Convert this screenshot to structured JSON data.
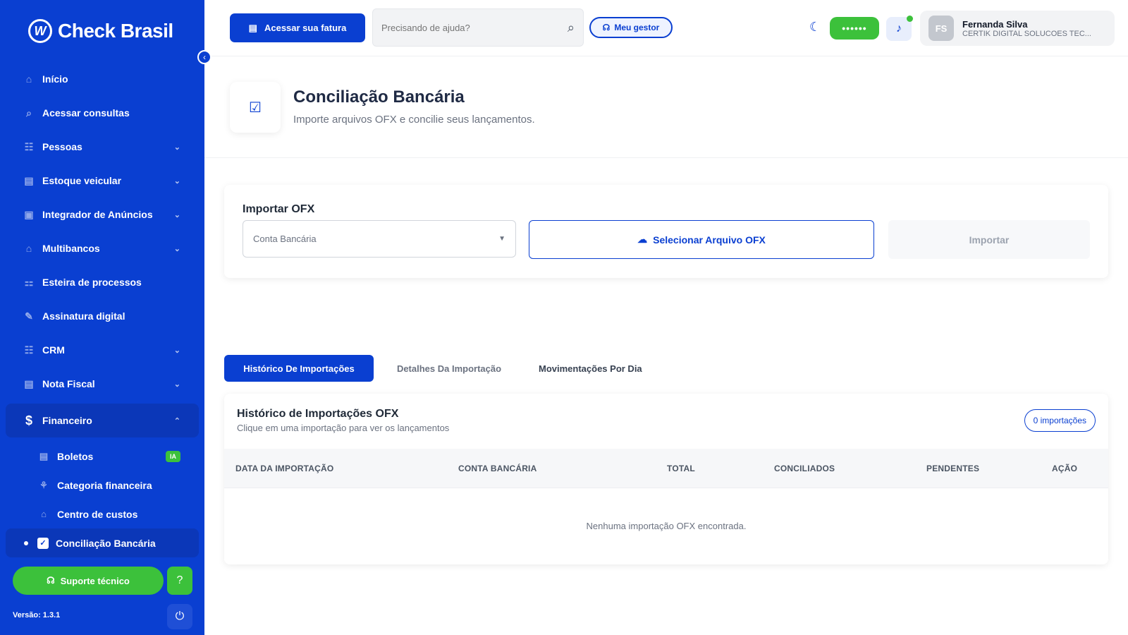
{
  "sidebar": {
    "brand": "Check Brasil",
    "brand_logo_letter": "W",
    "collapse_icon": "‹",
    "items": [
      {
        "label": "Início",
        "icon": "⌂",
        "chevron": ""
      },
      {
        "label": "Acessar consultas",
        "icon": "⌕",
        "chevron": ""
      },
      {
        "label": "Pessoas",
        "icon": "☷",
        "chevron": "⌄"
      },
      {
        "label": "Estoque veicular",
        "icon": "▤",
        "chevron": "⌄"
      },
      {
        "label": "Integrador de Anúncios",
        "icon": "▣",
        "chevron": "⌄"
      },
      {
        "label": "Multibancos",
        "icon": "⌂",
        "chevron": "⌄"
      },
      {
        "label": "Esteira de processos",
        "icon": "⚏",
        "chevron": ""
      },
      {
        "label": "Assinatura digital",
        "icon": "✎",
        "chevron": ""
      },
      {
        "label": "CRM",
        "icon": "☷",
        "chevron": "⌄"
      },
      {
        "label": "Nota Fiscal",
        "icon": "▤",
        "chevron": "⌄"
      }
    ],
    "active_item": {
      "label": "Financeiro",
      "icon": "$",
      "chevron": "⌃"
    },
    "sub_items": [
      {
        "label": "Boletos",
        "icon": "▤",
        "badge": "IA"
      },
      {
        "label": "Categoria financeira",
        "icon": "⚘",
        "badge": ""
      },
      {
        "label": "Centro de custos",
        "icon": "⌂",
        "badge": ""
      }
    ],
    "current_sub": {
      "label": "Conciliação Bancária",
      "icon": "✓"
    },
    "support_label": "Suporte técnico",
    "support_icon": "☊",
    "help_icon": "?",
    "version": "Versão: 1.3.1",
    "power_icon": "⏻"
  },
  "header": {
    "invoice_button": "Acessar sua fatura",
    "invoice_icon": "▤",
    "search_placeholder": "Precisando de ajuda?",
    "search_icon": "⌕",
    "manager_button": "Meu gestor",
    "manager_icon": "☊",
    "moon_icon": "☾",
    "masked_value": "••••••",
    "bell_icon": "♪",
    "user": {
      "initials": "FS",
      "name": "Fernanda Silva",
      "company": "CERTIK DIGITAL SOLUCOES TEC..."
    }
  },
  "page": {
    "icon": "☑",
    "title": "Conciliação Bancária",
    "subtitle": "Importe arquivos OFX e concilie seus lançamentos."
  },
  "import": {
    "label": "Importar OFX",
    "account_placeholder": "Conta Bancária",
    "caret": "▼",
    "select_file_button": "Selecionar Arquivo OFX",
    "upload_icon": "☁",
    "import_button": "Importar"
  },
  "tabs": [
    "Histórico De Importações",
    "Detalhes Da Importação",
    "Movimentações Por Dia"
  ],
  "history": {
    "title": "Histórico de Importações OFX",
    "subtitle": "Clique em uma importação para ver os lançamentos",
    "count": "0 importações",
    "columns": [
      "DATA DA IMPORTAÇÃO",
      "CONTA BANCÁRIA",
      "TOTAL",
      "CONCILIADOS",
      "PENDENTES",
      "AÇÃO"
    ],
    "empty_message": "Nenhuma importação OFX encontrada."
  },
  "colors": {
    "primary": "#0a3fd1",
    "success": "#3cc13b"
  }
}
